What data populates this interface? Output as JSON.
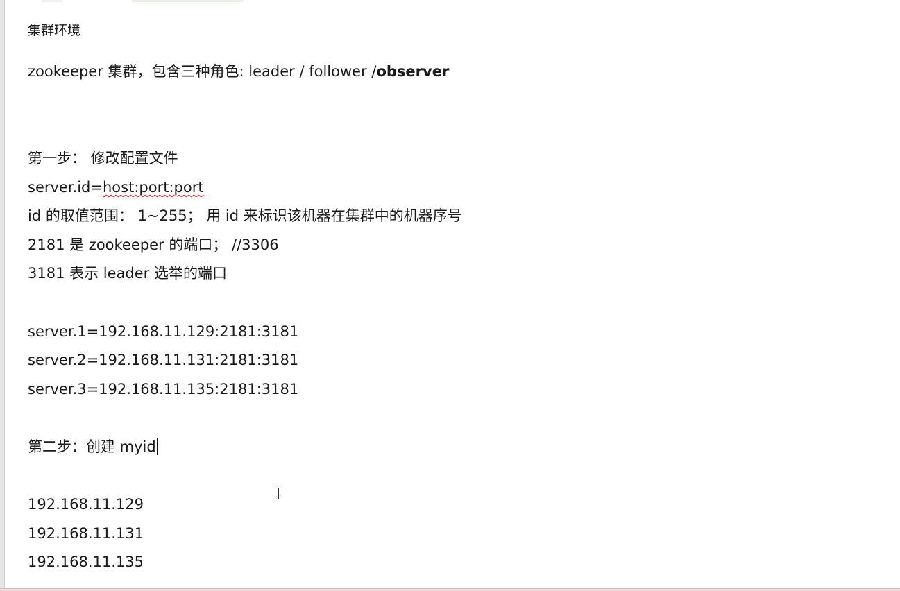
{
  "document": {
    "heading": "集群环境",
    "intro_prefix": "zookeeper 集群，包含三种角色: leader / follower /",
    "intro_bold": "observer",
    "step1_title": "第一步： 修改配置文件",
    "config_prefix": "server.id=",
    "config_value": "host:port:port",
    "id_range_line": "id 的取值范围： 1~255； 用 id 来标识该机器在集群中的机器序号",
    "port_2181_line": "2181 是 zookeeper 的端口； //3306",
    "port_3181_line": "3181 表示 leader 选举的端口",
    "servers": [
      "server.1=192.168.11.129:2181:3181",
      "server.2=192.168.11.131:2181:3181",
      "server.3=192.168.11.135:2181:3181"
    ],
    "step2_title": "第二步：创建 myid",
    "ips": [
      "192.168.11.129",
      "192.168.11.131",
      "192.168.11.135"
    ]
  }
}
